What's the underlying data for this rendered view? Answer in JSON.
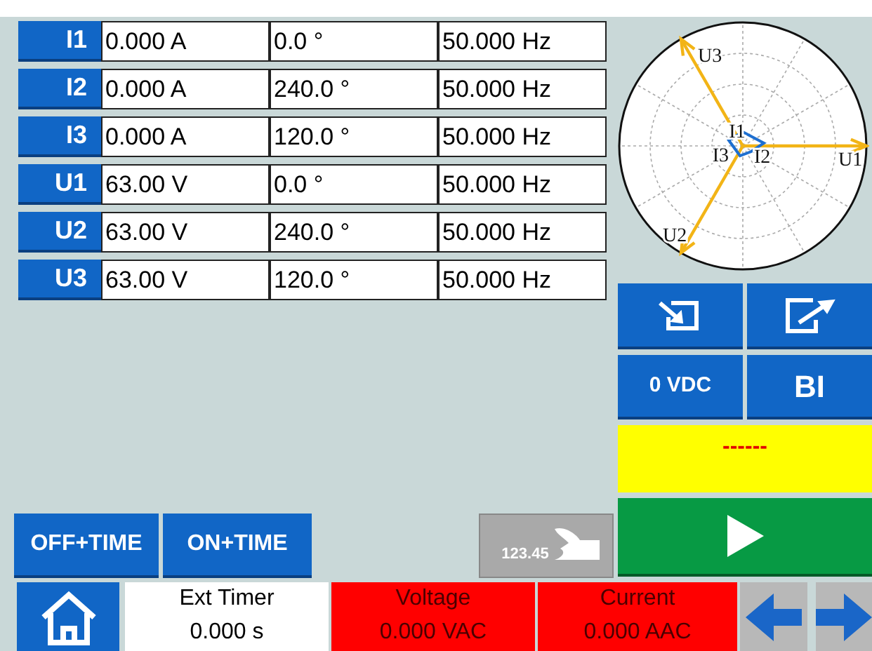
{
  "channels": [
    {
      "name": "I1",
      "magnitude": "0.000 A",
      "angle": "0.0 °",
      "frequency": "50.000 Hz"
    },
    {
      "name": "I2",
      "magnitude": "0.000 A",
      "angle": "240.0 °",
      "frequency": "50.000 Hz"
    },
    {
      "name": "I3",
      "magnitude": "0.000 A",
      "angle": "120.0 °",
      "frequency": "50.000 Hz"
    },
    {
      "name": "U1",
      "magnitude": "63.00 V",
      "angle": "0.0 °",
      "frequency": "50.000 Hz"
    },
    {
      "name": "U2",
      "magnitude": "63.00 V",
      "angle": "240.0 °",
      "frequency": "50.000 Hz"
    },
    {
      "name": "U3",
      "magnitude": "63.00 V",
      "angle": "120.0 °",
      "frequency": "50.000 Hz"
    }
  ],
  "phasor_labels": [
    "U3",
    "I1",
    "I3",
    "I2",
    "U1",
    "U2"
  ],
  "dc_button": "0 VDC",
  "bi_button": "BI",
  "status_display": "------",
  "time_buttons": [
    "OFF+TIME",
    "ON+TIME"
  ],
  "manual_badge": "123.45",
  "readouts": [
    {
      "label": "Ext Timer",
      "value": "0.000 s",
      "alarm": false
    },
    {
      "label": "Voltage",
      "value": "0.000 VAC",
      "alarm": true
    },
    {
      "label": "Current",
      "value": "0.000 AAC",
      "alarm": true
    }
  ]
}
